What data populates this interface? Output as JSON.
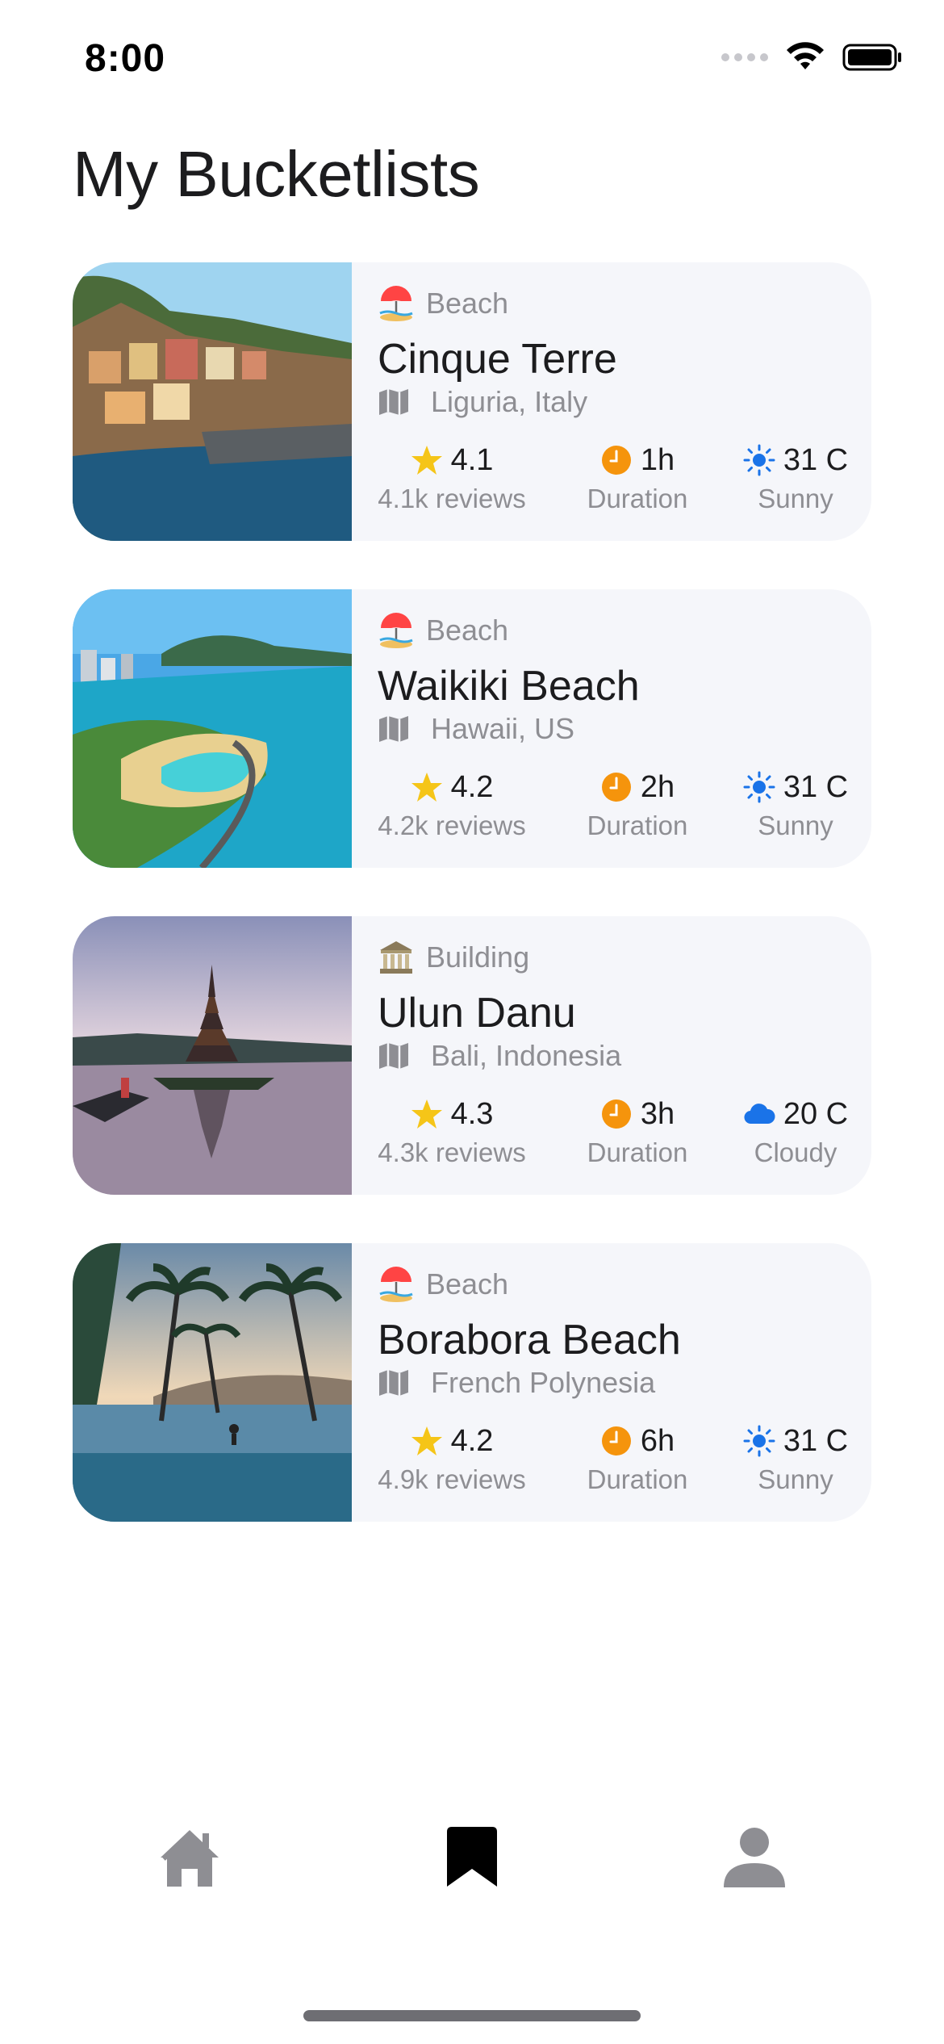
{
  "status_bar": {
    "time": "8:00"
  },
  "page": {
    "title": "My Bucketlists"
  },
  "cards": [
    {
      "category": "Beach",
      "category_icon": "beach-umbrella-icon",
      "title": "Cinque Terre",
      "location": "Liguria, Italy",
      "rating": "4.1",
      "reviews": "4.1k reviews",
      "duration": "1h",
      "duration_label": "Duration",
      "temperature": "31 C",
      "weather": "Sunny",
      "weather_icon": "sun-icon"
    },
    {
      "category": "Beach",
      "category_icon": "beach-umbrella-icon",
      "title": "Waikiki Beach",
      "location": "Hawaii, US",
      "rating": "4.2",
      "reviews": "4.2k reviews",
      "duration": "2h",
      "duration_label": "Duration",
      "temperature": "31 C",
      "weather": "Sunny",
      "weather_icon": "sun-icon"
    },
    {
      "category": "Building",
      "category_icon": "classical-building-icon",
      "title": "Ulun Danu",
      "location": "Bali, Indonesia",
      "rating": "4.3",
      "reviews": "4.3k reviews",
      "duration": "3h",
      "duration_label": "Duration",
      "temperature": "20 C",
      "weather": "Cloudy",
      "weather_icon": "cloud-icon"
    },
    {
      "category": "Beach",
      "category_icon": "beach-umbrella-icon",
      "title": "Borabora Beach",
      "location": "French Polynesia",
      "rating": "4.2",
      "reviews": "4.9k reviews",
      "duration": "6h",
      "duration_label": "Duration",
      "temperature": "31 C",
      "weather": "Sunny",
      "weather_icon": "sun-icon"
    }
  ],
  "tab_bar": {
    "active": "bucketlist",
    "tabs": [
      {
        "icon": "home-icon"
      },
      {
        "icon": "bookmark-icon"
      },
      {
        "icon": "person-icon"
      }
    ]
  },
  "colors": {
    "card_background": "#f5f6fa",
    "star": "#f5c518",
    "clock": "#f5940c",
    "weather_blue": "#1a73e8",
    "secondary_text": "#8e8e93"
  }
}
